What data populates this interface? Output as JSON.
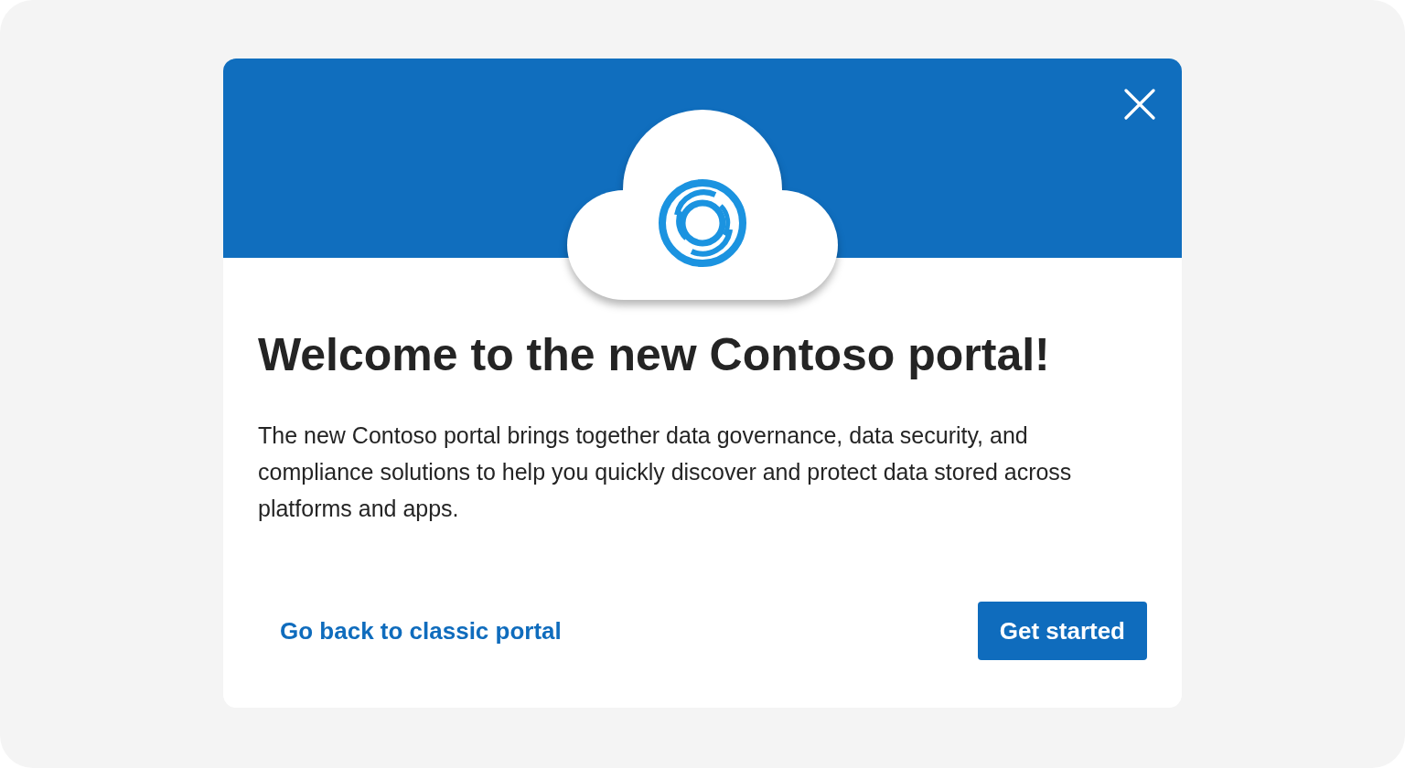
{
  "dialog": {
    "title": "Welcome to the new Contoso portal!",
    "description": "The new Contoso portal brings together data governance, data security, and compliance solutions to help you quickly discover and protect data stored across platforms and apps.",
    "secondary_link": "Go back to classic portal",
    "primary_button": "Get started"
  }
}
